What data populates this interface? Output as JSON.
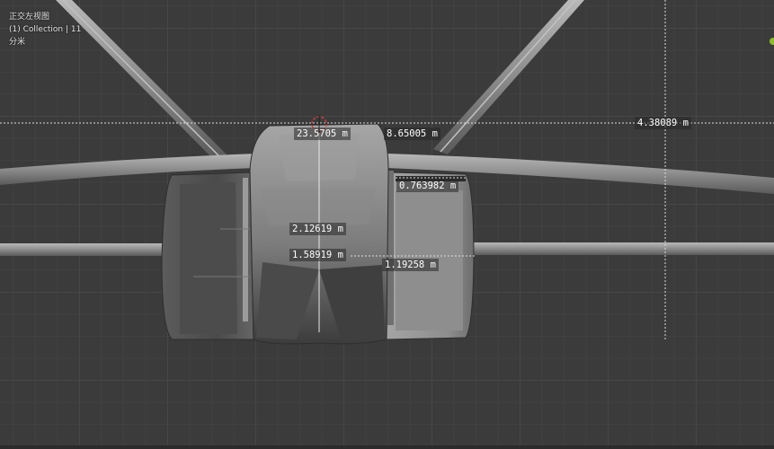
{
  "viewport": {
    "view_name": "正交左视图",
    "collection_line": "(1) Collection | 11",
    "unit_label": "分米"
  },
  "measurements": [
    {
      "id": "m1",
      "text": "23.5705 m"
    },
    {
      "id": "m2",
      "text": "8.65005 m"
    },
    {
      "id": "m3",
      "text": "4.38089 m"
    },
    {
      "id": "m4",
      "text": "0.763982 m"
    },
    {
      "id": "m5",
      "text": "2.12619 m"
    },
    {
      "id": "m6",
      "text": "1.58919 m"
    },
    {
      "id": "m7",
      "text": "1.19258 m"
    }
  ],
  "colors": {
    "background": "#3b3b3b",
    "mesh_light": "#9a9a9a",
    "mesh_dark": "#4a4a4a",
    "gizmo_accent": "#8dbd2a",
    "cursor_red": "#d04040"
  }
}
